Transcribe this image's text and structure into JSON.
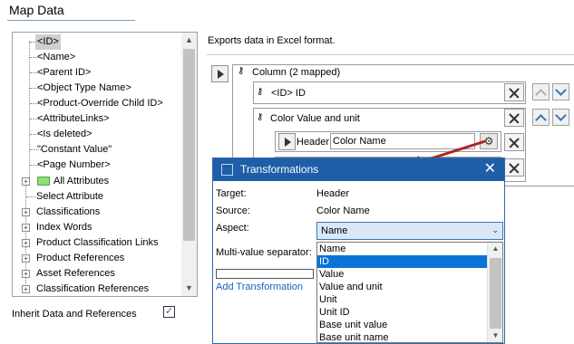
{
  "header": {
    "title": "Map Data"
  },
  "tree": {
    "items": [
      {
        "label": "<ID>",
        "selected": true
      },
      {
        "label": "<Name>"
      },
      {
        "label": "<Parent ID>"
      },
      {
        "label": "<Object Type Name>"
      },
      {
        "label": "<Product-Override Child ID>"
      },
      {
        "label": "<AttributeLinks>"
      },
      {
        "label": "<Is deleted>"
      },
      {
        "label": "\"Constant Value\""
      },
      {
        "label": "<Page Number>"
      },
      {
        "label": "All Attributes"
      },
      {
        "label": "Select Attribute"
      },
      {
        "label": "Classifications"
      },
      {
        "label": "Index Words"
      },
      {
        "label": "Product Classification Links"
      },
      {
        "label": "Product References"
      },
      {
        "label": "Asset References"
      },
      {
        "label": "Classification References"
      }
    ]
  },
  "inherit": {
    "label": "Inherit Data and References",
    "checked": true,
    "check_mark": "✓"
  },
  "right": {
    "description": "Exports data in Excel format.",
    "column_label": "Column (2 mapped)",
    "id_mapping": "<ID> ID",
    "color_group": "Color Value and unit",
    "header_label": "Header",
    "header_value": "Color Name"
  },
  "dialog": {
    "title": "Transformations",
    "close_glyph": "✕",
    "target_label": "Target:",
    "target_value": "Header",
    "source_label": "Source:",
    "source_value": "Color Name",
    "aspect_label": "Aspect:",
    "aspect_value": "Name",
    "separator_label": "Multi-value separator:",
    "add_link": "Add Transformation",
    "options": [
      "Name",
      "ID",
      "Value",
      "Value and unit",
      "Unit",
      "Unit ID",
      "Base unit value",
      "Base unit name"
    ],
    "selected_option": "ID"
  },
  "icons": {
    "expand": "+",
    "scroll_up": "▲",
    "scroll_down": "▼",
    "dropdown": "⌄",
    "key": "⚷",
    "gear": "⚙"
  },
  "colors": {
    "dialog_title_bg": "#1f5ea8",
    "selection": "#0a73d6",
    "link": "#1c5fc4",
    "arrow": "#b22222"
  }
}
